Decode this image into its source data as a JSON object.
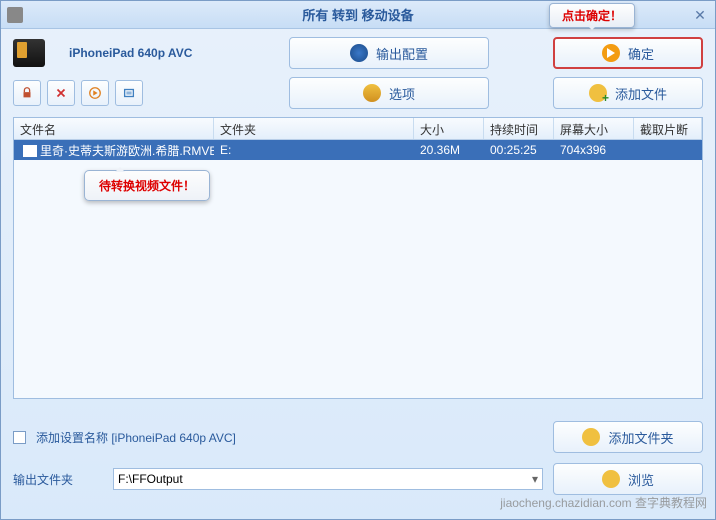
{
  "titlebar": {
    "title": "所有 转到 移动设备"
  },
  "callouts": {
    "ok": "点击确定！",
    "file": "待转换视频文件！"
  },
  "profile": {
    "label": "iPhoneiPad 640p AVC"
  },
  "buttons": {
    "output_config": "输出配置",
    "ok": "确定",
    "options": "选项",
    "add_file": "添加文件",
    "add_folder": "添加文件夹",
    "browse": "浏览"
  },
  "table": {
    "headers": {
      "name": "文件名",
      "folder": "文件夹",
      "size": "大小",
      "duration": "持续时间",
      "dimensions": "屏幕大小",
      "clip": "截取片断"
    },
    "row": {
      "name": "里奇·史蒂夫斯游欧洲.希腊.RMVB",
      "folder": "E:",
      "size": "20.36M",
      "duration": "00:25:25",
      "dimensions": "704x396"
    }
  },
  "footer": {
    "add_profile_label": "添加设置名称 [iPhoneiPad 640p AVC]",
    "output_folder_label": "输出文件夹",
    "output_folder_value": "F:\\FFOutput"
  },
  "watermark": "jiaocheng.chazidian.com 查字典教程网"
}
